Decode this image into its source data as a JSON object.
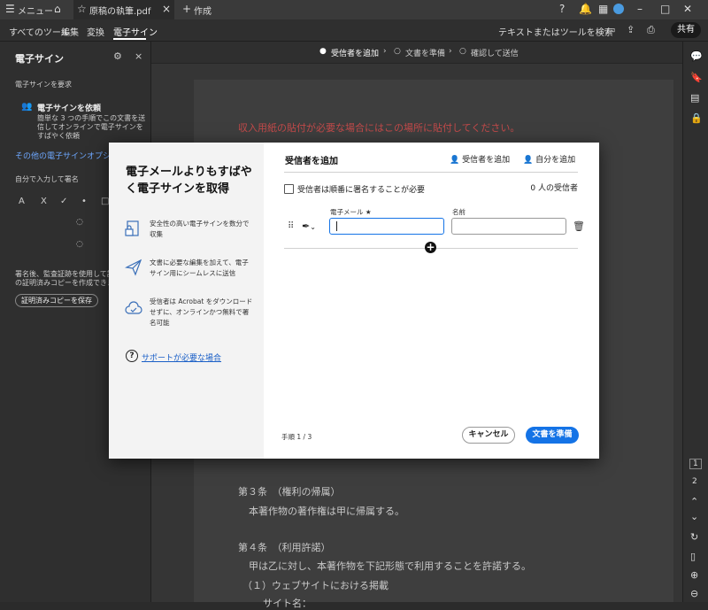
{
  "titlebar": {
    "menu_label": "メニュー",
    "file_tab": "原稿の執筆.pdf",
    "new_tab": "作成"
  },
  "toolbar": {
    "items": [
      "すべてのツール",
      "編集",
      "変換",
      "電子サイン"
    ],
    "search_placeholder": "テキストまたはツールを検索",
    "share_label": "共有"
  },
  "leftpanel": {
    "title": "電子サイン",
    "section_request": "電子サインを要求",
    "request_title": "電子サインを依頼",
    "request_desc": [
      "簡単な 3 つの手順でこの文書を送",
      "信してオンラインで電子サインを",
      "すばやく依頼"
    ],
    "other_options": "その他の電子サインオプション",
    "self_sign": "自分で入力して署名",
    "sign_tools": [
      "A",
      "X",
      "✓",
      "•",
      "□"
    ],
    "note": [
      "署名後、監査証跡を使用して読み",
      "の証明済みコピーを作成できます"
    ],
    "save_certified": "証明済みコピーを保存"
  },
  "steps": {
    "step1": "受信者を追加",
    "step2": "文書を準備",
    "step3": "確認して送信"
  },
  "document": {
    "line_red": "収入用紙の貼付が必要な場合にはこの場所に貼付してください。",
    "art3": "第３条　（権利の帰属）",
    "art3_body": "本著作物の著作権は甲に帰属する。",
    "art4": "第４条　（利用許諾）",
    "art4_body": "甲は乙に対し、本著作物を下記形態で利用することを許諾する。",
    "art4_item1": "（１）ウェブサイトにおける掲載",
    "art4_item1_sub": "サイト名："
  },
  "modal": {
    "left": {
      "title": "電子メールよりもすばやく電子サインを取得",
      "features": [
        {
          "icon": "secure-doc-icon",
          "text": "安全性の高い電子サインを数分で収集"
        },
        {
          "icon": "send-icon",
          "text": "文書に必要な編集を加えて、電子サイン用にシームレスに送信"
        },
        {
          "icon": "cloud-check-icon",
          "text": "受信者は Acrobat をダウンロードせずに、オンラインかつ無料で署名可能"
        }
      ],
      "support": "サポートが必要な場合"
    },
    "right": {
      "title": "受信者を追加",
      "add_recipient": "受信者を追加",
      "add_me": "自分を追加",
      "order_label": "受信者は順番に署名することが必要",
      "recipient_count": "0 人の受信者",
      "email_label": "電子メール ★",
      "name_label": "名前",
      "email_value": "",
      "name_value": "",
      "step_label": "手順 1 / 3",
      "cancel": "キャンセル",
      "prepare": "文書を準備"
    }
  },
  "rightrail": {
    "page_current": "1",
    "page_total": "2"
  }
}
